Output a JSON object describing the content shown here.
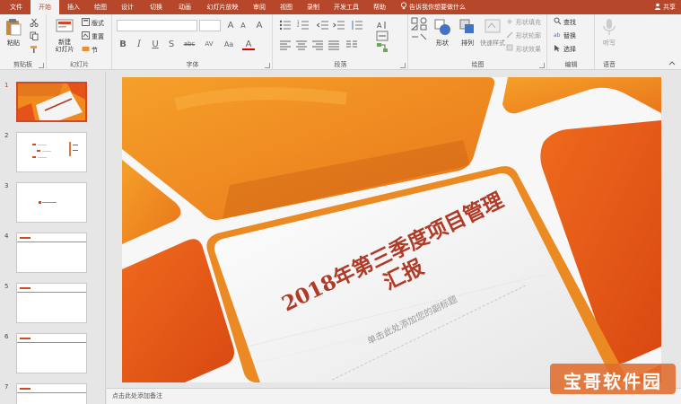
{
  "tabs": [
    {
      "label": "文件",
      "active": false
    },
    {
      "label": "开始",
      "active": true
    },
    {
      "label": "插入",
      "active": false
    },
    {
      "label": "绘图",
      "active": false
    },
    {
      "label": "设计",
      "active": false
    },
    {
      "label": "切换",
      "active": false
    },
    {
      "label": "动画",
      "active": false
    },
    {
      "label": "幻灯片放映",
      "active": false
    },
    {
      "label": "审阅",
      "active": false
    },
    {
      "label": "视图",
      "active": false
    },
    {
      "label": "录制",
      "active": false
    },
    {
      "label": "开发工具",
      "active": false
    },
    {
      "label": "帮助",
      "active": false
    }
  ],
  "tell_me": "告诉我你想要做什么",
  "share": "共享",
  "ribbon": {
    "clipboard": {
      "paste": "粘贴",
      "label": "剪贴板"
    },
    "slides": {
      "new_slide": "新建\n幻灯片",
      "new_slide_line1": "新建",
      "new_slide_line2": "幻灯片",
      "layout": "版式",
      "reset": "重置",
      "section": "节",
      "label": "幻灯片"
    },
    "font": {
      "label": "字体",
      "bold": "B",
      "italic": "I",
      "underline": "U",
      "shadow": "S",
      "strike": "abc",
      "grow": "A",
      "shrink": "A",
      "clear": "A",
      "spacing": "AV",
      "case": "Aa",
      "color": "A"
    },
    "paragraph": {
      "label": "段落"
    },
    "drawing": {
      "shapes": "形状",
      "arrange": "排列",
      "quick_styles": "快速样式",
      "fill": "形状填充",
      "outline": "形状轮廓",
      "effects": "形状效果",
      "label": "绘图"
    },
    "editing": {
      "find": "查找",
      "replace": "替换",
      "select": "选择",
      "label": "编辑"
    },
    "voice": {
      "dictate": "听写",
      "label": "语音"
    }
  },
  "thumbnails": [
    {
      "number": "1",
      "active": true
    },
    {
      "number": "2",
      "active": false
    },
    {
      "number": "3",
      "active": false
    },
    {
      "number": "4",
      "active": false
    },
    {
      "number": "5",
      "active": false
    },
    {
      "number": "6",
      "active": false
    },
    {
      "number": "7",
      "active": false
    }
  ],
  "slide": {
    "title_line1": "2018年第三季度项目管理",
    "title_line2": "汇报",
    "subtitle": "单击此处添加您的副标题"
  },
  "notes_placeholder": "点击此处添加备注",
  "watermark": "宝哥软件园",
  "colors": {
    "accent": "#b7472a",
    "slide_orange": "#f08a1c",
    "slide_deep_orange": "#e5531a",
    "title_red": "#b03a26"
  }
}
